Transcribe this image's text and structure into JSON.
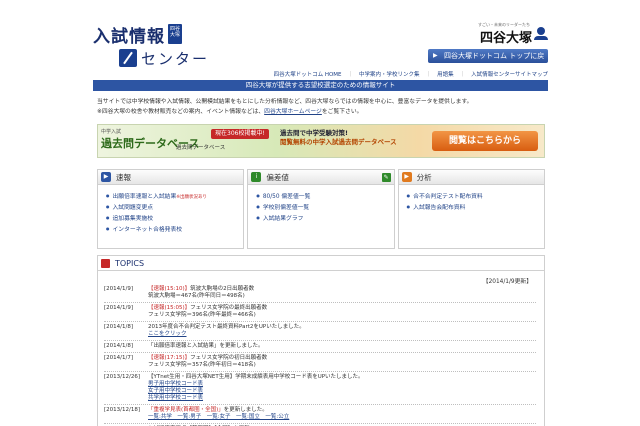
{
  "header": {
    "title_line1": "入試情報",
    "stamp": "四谷大塚",
    "title_line2": "センター",
    "logo_tagline": "すごい・未来のリーダーたち",
    "logo_name": "四谷大塚",
    "top_button": "四谷大塚ドットコム トップに戻る"
  },
  "breadcrumb": [
    "四谷大塚ドットコム HOME",
    "中学案内・学校リンク集",
    "用語集",
    "入試情報センターサイトマップ"
  ],
  "bluebar": "四谷大塚が提供する志望校選定のための情報サイト",
  "intro": {
    "line1": "当サイトでは中学校情報や入試情報、公開模試結果をもとにした分析情報など、四谷大塚ならではの情報を中心に、豊富なデータを提供します。",
    "line2_pre": "※四谷大塚の校舎や教材販売などの案内、イベント情報などは、",
    "line2_link": "四谷大塚ホームページ",
    "line2_post": "をご覧下さい。"
  },
  "banner": {
    "small": "中学入試",
    "big": "過去問データベース",
    "badge": "現在306校掲載中!",
    "sub": "過去問データベース",
    "mid_line1": "過去問で中学受験対策!",
    "mid_line2": "閲覧無料の中学入試過去問データベース",
    "button": "閲覧はこちらから"
  },
  "columns": [
    {
      "title": "速報",
      "items": [
        {
          "text": "出願倍率速報と入試結果",
          "note": "※出願状況あり"
        },
        {
          "text": "入試問題変更点"
        },
        {
          "text": "追加募集実施校"
        },
        {
          "text": "インターネット合格発表校"
        }
      ]
    },
    {
      "title": "偏差値",
      "items": [
        {
          "text": "80/50 偏差値一覧"
        },
        {
          "text": "学校別偏差値一覧"
        },
        {
          "text": "入試結果グラフ"
        }
      ]
    },
    {
      "title": "分析",
      "items": [
        {
          "text": "合不合判定テスト配布資料"
        },
        {
          "text": "入試報告会配布資料"
        }
      ]
    }
  ],
  "topics": {
    "title": "TOPICS",
    "updated": "【2014/1/9更新】",
    "rows": [
      {
        "date": "[2014/1/9]",
        "lines": [
          {
            "red": "【速報(15:10)】",
            "text": "筑波大駒場の2日出願者数"
          },
          {
            "text": "筑波大駒場＝467名(昨年同日＝498名)"
          }
        ]
      },
      {
        "date": "[2014/1/9]",
        "lines": [
          {
            "red": "【速報(15:05)】",
            "text": "フェリス女学院の最終出願者数"
          },
          {
            "text": "フェリス女学院＝396名(昨年最終＝466名)"
          }
        ]
      },
      {
        "date": "[2014/1/8]",
        "lines": [
          {
            "text": "2013年度合不合判定テスト最終資料Part2をUPいたしました。"
          },
          {
            "link": "ここをクリック"
          }
        ]
      },
      {
        "date": "[2014/1/8]",
        "lines": [
          {
            "text": "「出願倍率速報と入試結果」を更新しました。"
          }
        ]
      },
      {
        "date": "[2014/1/7]",
        "lines": [
          {
            "red": "【速報(17:15)】",
            "text": "フェリス女学院の初日出願者数"
          },
          {
            "text": "フェリス女学院＝357名(昨年初日＝418名)"
          }
        ]
      },
      {
        "date": "[2013/12/26]",
        "lines": [
          {
            "text": "【YTnet生用・四谷大塚NET生用】学期末成績表用中学校コード表をUPいたしました。"
          },
          {
            "link": "男子用中学校コード表"
          },
          {
            "link": "女子用中学校コード表"
          },
          {
            "link": "共学用中学校コード表"
          }
        ]
      },
      {
        "date": "[2013/12/18]",
        "lines": [
          {
            "red": "「重複学見表(首都圏・全国)」",
            "text": "を更新しました。"
          },
          {
            "link": "一覧:共学　一覧:男子　一覧:女子　一覧:国立　一覧:公立"
          }
        ]
      },
      {
        "date": "[2013/11/1]",
        "lines": [
          {
            "text": "入試関連変更点【首都圏】【全国】を更新"
          },
          {
            "text": "「男子校」「女子校」「共学校」「国・公立校」「全国主要校」を更新いたしました。"
          }
        ]
      }
    ]
  }
}
